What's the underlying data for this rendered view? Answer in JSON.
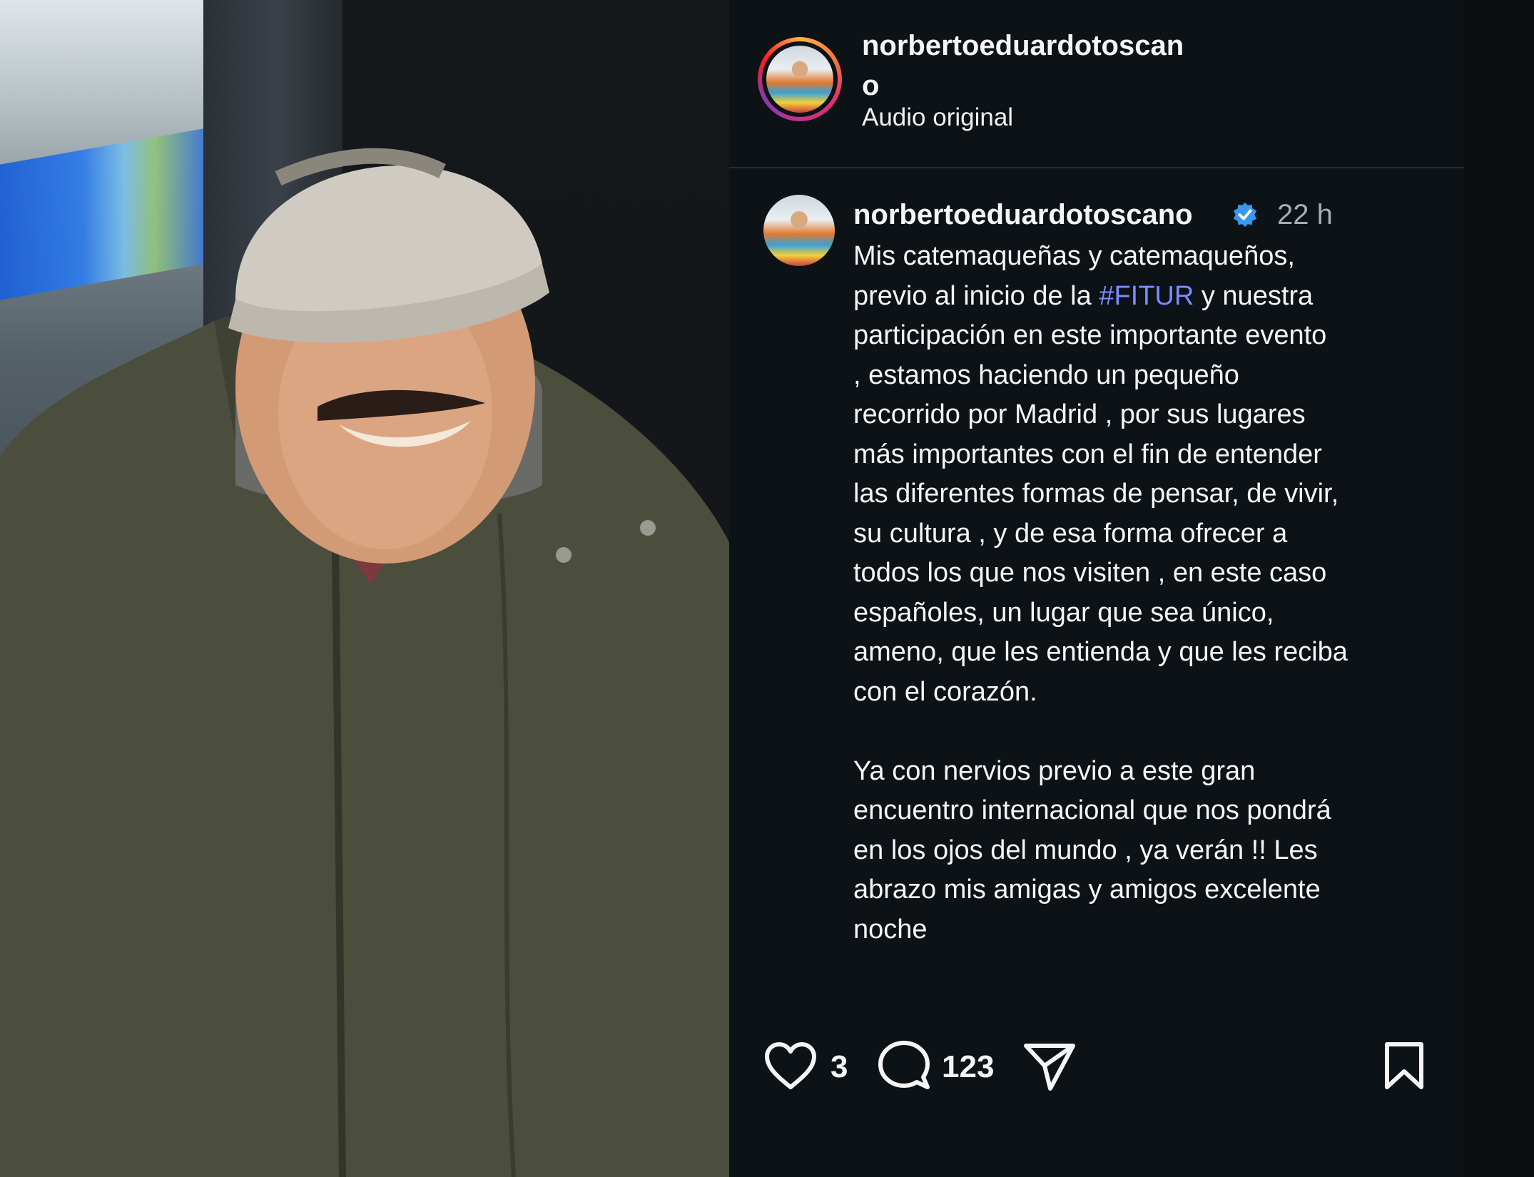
{
  "header": {
    "username_line1": "norbertoeduardotoscan",
    "username_line2": "o",
    "audio_label": "Audio original"
  },
  "caption": {
    "username": "norbertoeduardotoscano",
    "time": "22 h",
    "text_before_tag": "Mis catemaqueñas y catemaqueños,\nprevio al inicio de la ",
    "hashtag": "#FITUR",
    "text_after_tag": " y nuestra\nparticipación en este importante evento\n, estamos haciendo un pequeño\nrecorrido por Madrid , por sus lugares\nmás importantes con el fin de entender\nlas diferentes formas de pensar, de vivir,\nsu cultura , y de esa forma ofrecer a\ntodos los que nos visiten , en este caso\nespañoles, un lugar que sea único,\nameno, que les entienda y que les reciba\ncon el corazón.\n\nYa con nervios previo a este gran\nencuentro internacional que nos pondrá\nen los ojos del mundo , ya verán !! Les\nabrazo mis amigas y amigos excelente\nnoche"
  },
  "actions": {
    "likes": "3",
    "comments": "123",
    "icons": [
      "heart-icon",
      "comment-icon",
      "share-icon",
      "bookmark-icon"
    ]
  },
  "colors": {
    "panel_bg": "#0d1217",
    "hashtag": "#7b8cff",
    "verified": "#3897f0"
  }
}
